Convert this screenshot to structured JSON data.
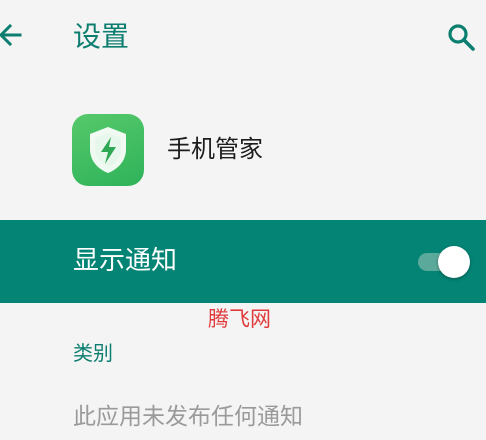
{
  "header": {
    "title": "设置",
    "back_icon": "arrow-back-icon",
    "search_icon": "search-icon"
  },
  "app": {
    "name": "手机管家",
    "icon": "shield-bolt-icon"
  },
  "notifications": {
    "label": "显示通知",
    "enabled": true
  },
  "watermark": {
    "text": "腾飞网"
  },
  "category": {
    "header": "类别",
    "empty_message": "此应用未发布任何通知"
  },
  "colors": {
    "accent": "#0b7e6f",
    "notify_bg": "#038475",
    "app_icon": "#3dbb60",
    "watermark": "#e03a3a"
  }
}
